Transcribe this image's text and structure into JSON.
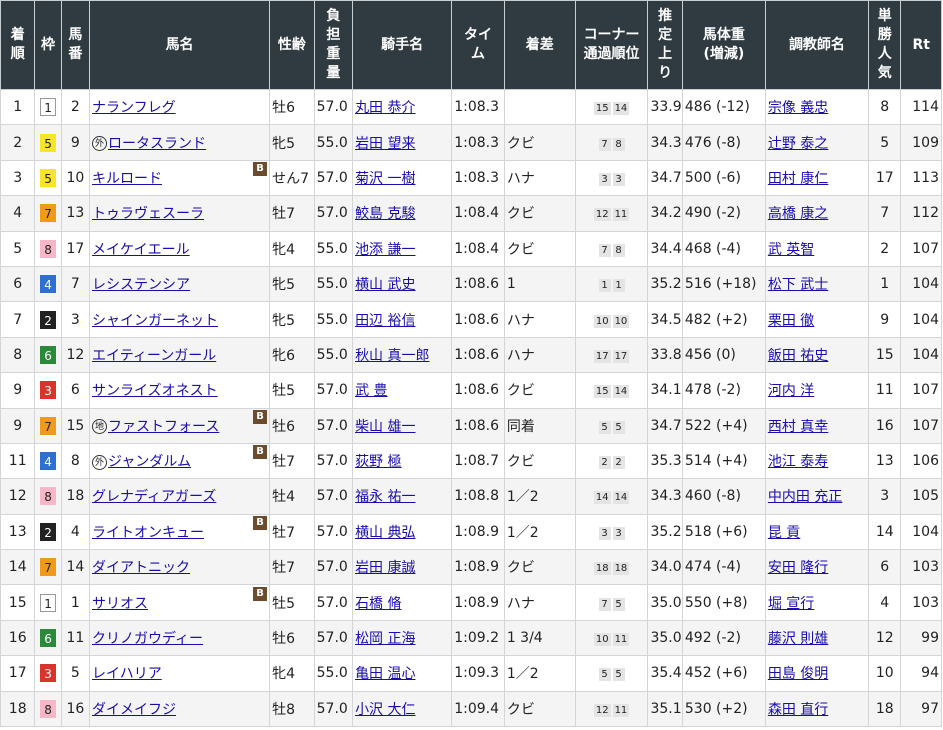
{
  "headers": {
    "finish": [
      "着",
      "順"
    ],
    "gate": "枠",
    "number": [
      "馬",
      "番"
    ],
    "horse": "馬名",
    "sex_age": "性齢",
    "weight": [
      "負",
      "担",
      "重",
      "量"
    ],
    "jockey": "騎手名",
    "time": [
      "タイ",
      "ム"
    ],
    "margin": "着差",
    "corner": [
      "コーナー",
      "通過順位"
    ],
    "last3f": [
      "推",
      "定",
      "上",
      "り"
    ],
    "body_weight": [
      "馬体重",
      "(増減)"
    ],
    "trainer": "調教師名",
    "odds_rank": [
      "単",
      "勝",
      "人",
      "気"
    ],
    "rating": "Rt"
  },
  "colors": {
    "header_bg": "#2f3b41",
    "link": "#1a0dab",
    "gate_colors": {
      "1": "#ffffff",
      "2": "#222222",
      "3": "#d9342b",
      "4": "#2f6fd0",
      "5": "#f7e52a",
      "6": "#2a8a3a",
      "7": "#f09a1d",
      "8": "#f7b7c8"
    },
    "blinker_bg": "#6d4b2d"
  },
  "rows": [
    {
      "finish": "1",
      "gate": "1",
      "num": "2",
      "mark": "",
      "horse": "ナランフレグ",
      "blinker": "",
      "sex_age": "牡6",
      "weight": "57.0",
      "jockey": "丸田 恭介",
      "time": "1:08.3",
      "margin": "",
      "corner": [
        "15",
        "14"
      ],
      "last3f": "33.9",
      "body": "486 (-12)",
      "trainer": "宗像 義忠",
      "pop": "8",
      "rt": "114"
    },
    {
      "finish": "2",
      "gate": "5",
      "num": "9",
      "mark": "外",
      "horse": "ロータスランド",
      "blinker": "",
      "sex_age": "牝5",
      "weight": "55.0",
      "jockey": "岩田 望来",
      "time": "1:08.3",
      "margin": "クビ",
      "corner": [
        "7",
        "8"
      ],
      "last3f": "34.3",
      "body": "476 (-8)",
      "trainer": "辻野 泰之",
      "pop": "5",
      "rt": "109"
    },
    {
      "finish": "3",
      "gate": "5",
      "num": "10",
      "mark": "",
      "horse": "キルロード",
      "blinker": "B",
      "sex_age": "せん7",
      "weight": "57.0",
      "jockey": "菊沢 一樹",
      "time": "1:08.3",
      "margin": "ハナ",
      "corner": [
        "3",
        "3"
      ],
      "last3f": "34.7",
      "body": "500 (-6)",
      "trainer": "田村 康仁",
      "pop": "17",
      "rt": "113"
    },
    {
      "finish": "4",
      "gate": "7",
      "num": "13",
      "mark": "",
      "horse": "トゥラヴェスーラ",
      "blinker": "",
      "sex_age": "牡7",
      "weight": "57.0",
      "jockey": "鮫島 克駿",
      "time": "1:08.4",
      "margin": "クビ",
      "corner": [
        "12",
        "11"
      ],
      "last3f": "34.2",
      "body": "490 (-2)",
      "trainer": "高橋 康之",
      "pop": "7",
      "rt": "112"
    },
    {
      "finish": "5",
      "gate": "8",
      "num": "17",
      "mark": "",
      "horse": "メイケイエール",
      "blinker": "",
      "sex_age": "牝4",
      "weight": "55.0",
      "jockey": "池添 謙一",
      "time": "1:08.4",
      "margin": "クビ",
      "corner": [
        "7",
        "8"
      ],
      "last3f": "34.4",
      "body": "468 (-4)",
      "trainer": "武 英智",
      "pop": "2",
      "rt": "107"
    },
    {
      "finish": "6",
      "gate": "4",
      "num": "7",
      "mark": "",
      "horse": "レシステンシア",
      "blinker": "",
      "sex_age": "牝5",
      "weight": "55.0",
      "jockey": "横山 武史",
      "time": "1:08.6",
      "margin": "1",
      "corner": [
        "1",
        "1"
      ],
      "last3f": "35.2",
      "body": "516 (+18)",
      "trainer": "松下 武士",
      "pop": "1",
      "rt": "104"
    },
    {
      "finish": "7",
      "gate": "2",
      "num": "3",
      "mark": "",
      "horse": "シャインガーネット",
      "blinker": "",
      "sex_age": "牝5",
      "weight": "55.0",
      "jockey": "田辺 裕信",
      "time": "1:08.6",
      "margin": "ハナ",
      "corner": [
        "10",
        "10"
      ],
      "last3f": "34.5",
      "body": "482 (+2)",
      "trainer": "栗田 徹",
      "pop": "9",
      "rt": "104"
    },
    {
      "finish": "8",
      "gate": "6",
      "num": "12",
      "mark": "",
      "horse": "エイティーンガール",
      "blinker": "",
      "sex_age": "牝6",
      "weight": "55.0",
      "jockey": "秋山 真一郎",
      "time": "1:08.6",
      "margin": "ハナ",
      "corner": [
        "17",
        "17"
      ],
      "last3f": "33.8",
      "body": "456 (0)",
      "trainer": "飯田 祐史",
      "pop": "15",
      "rt": "104"
    },
    {
      "finish": "9",
      "gate": "3",
      "num": "6",
      "mark": "",
      "horse": "サンライズオネスト",
      "blinker": "",
      "sex_age": "牡5",
      "weight": "57.0",
      "jockey": "武 豊",
      "time": "1:08.6",
      "margin": "クビ",
      "corner": [
        "15",
        "14"
      ],
      "last3f": "34.1",
      "body": "478 (-2)",
      "trainer": "河内 洋",
      "pop": "11",
      "rt": "107"
    },
    {
      "finish": "9",
      "gate": "7",
      "num": "15",
      "mark": "地",
      "horse": "ファストフォース",
      "blinker": "B",
      "sex_age": "牡6",
      "weight": "57.0",
      "jockey": "柴山 雄一",
      "time": "1:08.6",
      "margin": "同着",
      "corner": [
        "5",
        "5"
      ],
      "last3f": "34.7",
      "body": "522 (+4)",
      "trainer": "西村 真幸",
      "pop": "16",
      "rt": "107"
    },
    {
      "finish": "11",
      "gate": "4",
      "num": "8",
      "mark": "外",
      "horse": "ジャンダルム",
      "blinker": "B",
      "sex_age": "牡7",
      "weight": "57.0",
      "jockey": "荻野 極",
      "time": "1:08.7",
      "margin": "クビ",
      "corner": [
        "2",
        "2"
      ],
      "last3f": "35.3",
      "body": "514 (+4)",
      "trainer": "池江 泰寿",
      "pop": "13",
      "rt": "106"
    },
    {
      "finish": "12",
      "gate": "8",
      "num": "18",
      "mark": "",
      "horse": "グレナディアガーズ",
      "blinker": "",
      "sex_age": "牡4",
      "weight": "57.0",
      "jockey": "福永 祐一",
      "time": "1:08.8",
      "margin": "1／2",
      "corner": [
        "14",
        "14"
      ],
      "last3f": "34.3",
      "body": "460 (-8)",
      "trainer": "中内田 充正",
      "pop": "3",
      "rt": "105"
    },
    {
      "finish": "13",
      "gate": "2",
      "num": "4",
      "mark": "",
      "horse": "ライトオンキュー",
      "blinker": "B",
      "sex_age": "牡7",
      "weight": "57.0",
      "jockey": "横山 典弘",
      "time": "1:08.9",
      "margin": "1／2",
      "corner": [
        "3",
        "3"
      ],
      "last3f": "35.2",
      "body": "518 (+6)",
      "trainer": "昆 貢",
      "pop": "14",
      "rt": "104"
    },
    {
      "finish": "14",
      "gate": "7",
      "num": "14",
      "mark": "",
      "horse": "ダイアトニック",
      "blinker": "",
      "sex_age": "牡7",
      "weight": "57.0",
      "jockey": "岩田 康誠",
      "time": "1:08.9",
      "margin": "クビ",
      "corner": [
        "18",
        "18"
      ],
      "last3f": "34.0",
      "body": "474 (-4)",
      "trainer": "安田 隆行",
      "pop": "6",
      "rt": "103"
    },
    {
      "finish": "15",
      "gate": "1",
      "num": "1",
      "mark": "",
      "horse": "サリオス",
      "blinker": "B",
      "sex_age": "牡5",
      "weight": "57.0",
      "jockey": "石橋 脩",
      "time": "1:08.9",
      "margin": "ハナ",
      "corner": [
        "7",
        "5"
      ],
      "last3f": "35.0",
      "body": "550 (+8)",
      "trainer": "堀 宣行",
      "pop": "4",
      "rt": "103"
    },
    {
      "finish": "16",
      "gate": "6",
      "num": "11",
      "mark": "",
      "horse": "クリノガウディー",
      "blinker": "",
      "sex_age": "牡6",
      "weight": "57.0",
      "jockey": "松岡 正海",
      "time": "1:09.2",
      "margin": "1 3/4",
      "corner": [
        "10",
        "11"
      ],
      "last3f": "35.0",
      "body": "492 (-2)",
      "trainer": "藤沢 則雄",
      "pop": "12",
      "rt": "99"
    },
    {
      "finish": "17",
      "gate": "3",
      "num": "5",
      "mark": "",
      "horse": "レイハリア",
      "blinker": "",
      "sex_age": "牝4",
      "weight": "55.0",
      "jockey": "亀田 温心",
      "time": "1:09.3",
      "margin": "1／2",
      "corner": [
        "5",
        "5"
      ],
      "last3f": "35.4",
      "body": "452 (+6)",
      "trainer": "田島 俊明",
      "pop": "10",
      "rt": "94"
    },
    {
      "finish": "18",
      "gate": "8",
      "num": "16",
      "mark": "",
      "horse": "ダイメイフジ",
      "blinker": "",
      "sex_age": "牡8",
      "weight": "57.0",
      "jockey": "小沢 大仁",
      "time": "1:09.4",
      "margin": "クビ",
      "corner": [
        "12",
        "11"
      ],
      "last3f": "35.1",
      "body": "530 (+2)",
      "trainer": "森田 直行",
      "pop": "18",
      "rt": "97"
    }
  ]
}
